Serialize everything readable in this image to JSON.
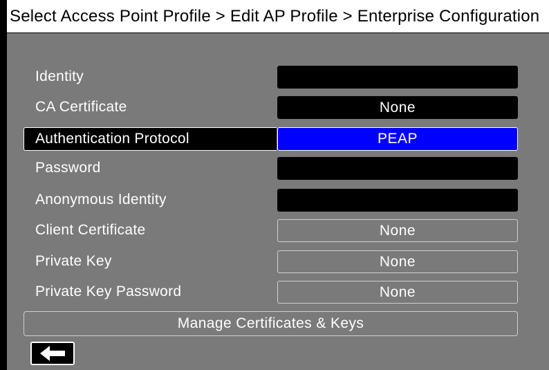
{
  "title": "Select Access Point Profile > Edit AP Profile > Enterprise Configuration",
  "fields": [
    {
      "label": "Identity",
      "value": ""
    },
    {
      "label": "CA Certificate",
      "value": "None"
    },
    {
      "label": "Authentication Protocol",
      "value": "PEAP"
    },
    {
      "label": "Password",
      "value": ""
    },
    {
      "label": "Anonymous Identity",
      "value": ""
    },
    {
      "label": "Client Certificate",
      "value": "None"
    },
    {
      "label": "Private Key",
      "value": "None"
    },
    {
      "label": "Private Key Password",
      "value": "None"
    }
  ],
  "manage_button": "Manage Certificates & Keys",
  "back_button": {
    "icon": "arrow-left-icon"
  },
  "colors": {
    "panel_bg": "#7a7a7a",
    "field_dark": "#000000",
    "selected_blue": "#0000ff",
    "text": "#ffffff"
  }
}
